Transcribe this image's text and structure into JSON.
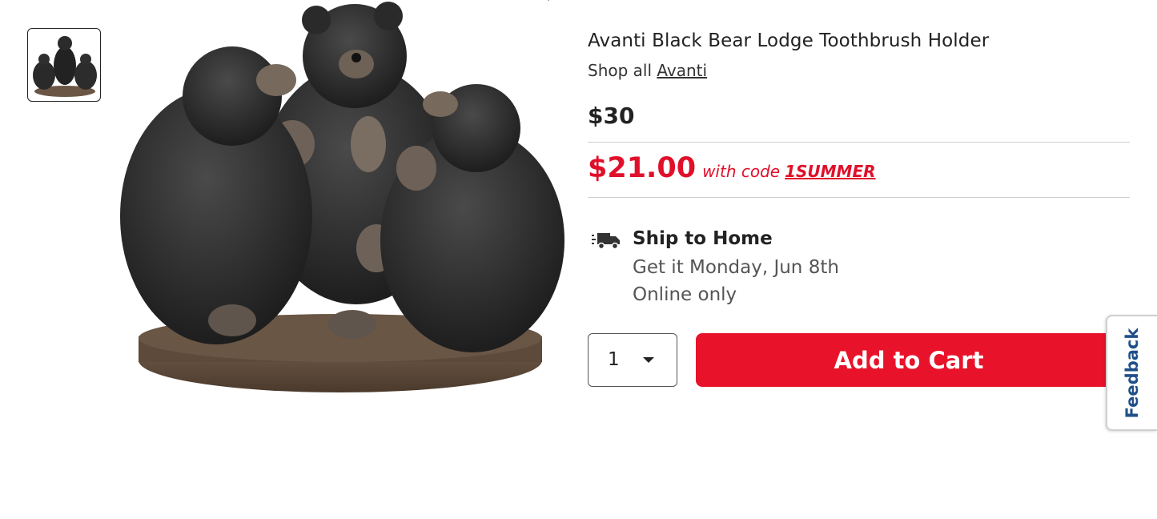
{
  "product": {
    "title": "Avanti Black Bear Lodge Toothbrush Holder",
    "shop_all_prefix": "Shop all",
    "brand_link": "Avanti",
    "original_price": "$30",
    "sale_price": "$21.00",
    "sale_note": "with code",
    "promo_code": "1SUMMER"
  },
  "gallery": {
    "thumbnail_icon": "bear-figurine-thumbnail",
    "main_image_icon": "bear-figurine-image"
  },
  "shipping": {
    "icon": "truck-icon",
    "title": "Ship to Home",
    "date": "Get it Monday, Jun 8th",
    "note": "Online only"
  },
  "cart": {
    "quantity": "1",
    "add_label": "Add to Cart"
  },
  "feedback": {
    "label": "Feedback"
  },
  "colors": {
    "accent_red": "#e8132a",
    "sale_red": "#e0102a",
    "feedback_blue": "#1f4f8a"
  }
}
